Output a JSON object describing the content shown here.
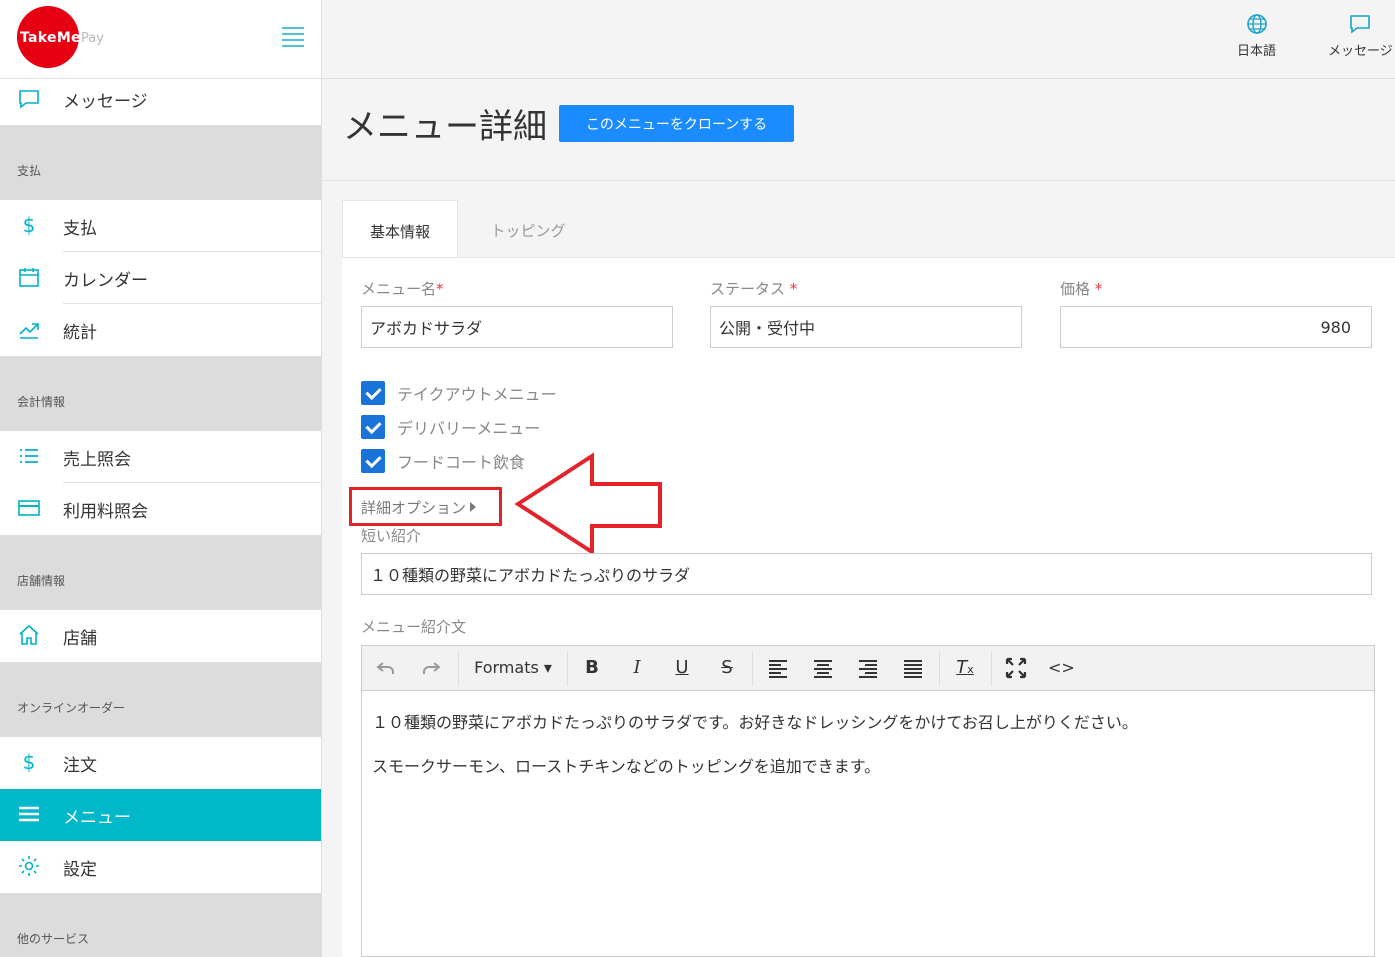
{
  "brand": {
    "name": "TakeMe",
    "suffix": "Pay"
  },
  "topbar": {
    "language": "日本語",
    "messages": "メッセージ"
  },
  "sidebar": {
    "top_item": "メッセージ",
    "sections": [
      {
        "header": "支払",
        "items": [
          "支払",
          "カレンダー",
          "統計"
        ]
      },
      {
        "header": "会計情報",
        "items": [
          "売上照会",
          "利用料照会"
        ]
      },
      {
        "header": "店舗情報",
        "items": [
          "店舗"
        ]
      },
      {
        "header": "オンラインオーダー",
        "items": [
          "注文",
          "メニュー",
          "設定"
        ]
      },
      {
        "header": "他のサービス",
        "items": []
      }
    ],
    "active_item": "メニュー"
  },
  "page": {
    "title": "メニュー詳細",
    "clone_button": "このメニューをクローンする"
  },
  "tabs": [
    "基本情報",
    "トッピング"
  ],
  "form": {
    "name_label": "メニュー名",
    "name_value": "アボカドサラダ",
    "status_label": "ステータス",
    "status_value": "公開・受付中",
    "price_label": "価格",
    "price_value": "980",
    "required_mark": "*",
    "checkboxes": [
      "テイクアウトメニュー",
      "デリバリーメニュー",
      "フードコート飲食"
    ],
    "advanced_options": "詳細オプション",
    "short_intro_label": "短い紹介",
    "short_intro_value": "１０種類の野菜にアボカドたっぷりのサラダ",
    "description_label": "メニュー紹介文"
  },
  "editor": {
    "formats_label": "Formats",
    "paragraphs": [
      "１０種類の野菜にアボカドたっぷりのサラダです。お好きなドレッシングをかけてお召し上がりください。",
      "スモークサーモン、ローストチキンなどのトッピングを追加できます。"
    ]
  },
  "colors": {
    "accent": "#00b8c9",
    "primary_button": "#1a8cff",
    "checkbox": "#1a73d9",
    "highlight_box": "#e4222a",
    "brand_red": "#e60012"
  }
}
